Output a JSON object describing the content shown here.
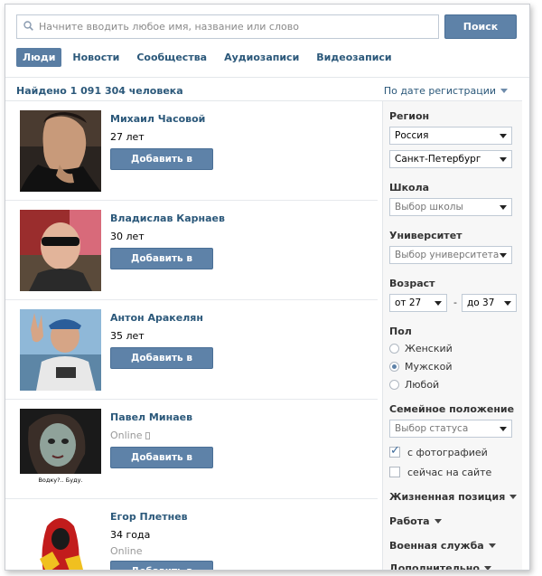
{
  "search": {
    "placeholder": "Начните вводить любое имя, название или слово",
    "button": "Поиск"
  },
  "tabs": [
    {
      "label": "Люди",
      "active": true
    },
    {
      "label": "Новости"
    },
    {
      "label": "Сообщества"
    },
    {
      "label": "Аудиозаписи"
    },
    {
      "label": "Видеозаписи"
    }
  ],
  "results": {
    "found": "Найдено 1 091 304 человека",
    "sort": "По дате регистрации"
  },
  "people": [
    {
      "name": "Михаил Часовой",
      "info": "27 лет",
      "button": "Добавить в друзья"
    },
    {
      "name": "Владислав Карнаев",
      "info": "30 лет",
      "button": "Добавить в друзья"
    },
    {
      "name": "Антон Аракелян",
      "info": "35 лет",
      "button": "Добавить в друзья"
    },
    {
      "name": "Павел Минаев",
      "info": "Online",
      "button": "Добавить в друзья",
      "photo_caption": "Водку?.. Буду."
    },
    {
      "name": "Егор Плетнев",
      "info": "34 года",
      "status": "Online",
      "button": "Добавить в друзья"
    }
  ],
  "filters": {
    "region_label": "Регион",
    "country": "Россия",
    "city": "Санкт-Петербург",
    "school_label": "Школа",
    "school": "Выбор школы",
    "university_label": "Университет",
    "university": "Выбор университета",
    "age_label": "Возраст",
    "age_from": "от 27",
    "age_dash": "-",
    "age_to": "до 37",
    "sex_label": "Пол",
    "sex_options": [
      "Женский",
      "Мужской",
      "Любой"
    ],
    "sex_selected": "Мужской",
    "marital_label": "Семейное положение",
    "marital": "Выбор статуса",
    "with_photo": "с фотографией",
    "with_photo_checked": true,
    "online_now": "сейчас на сайте",
    "online_now_checked": false,
    "collapsed": [
      "Жизненная позиция",
      "Работа",
      "Военная служба",
      "Дополнительно"
    ]
  },
  "colors": {
    "accent": "#5e82a8",
    "link": "#2b587a",
    "sidebar_bg": "#f7f7f7"
  }
}
